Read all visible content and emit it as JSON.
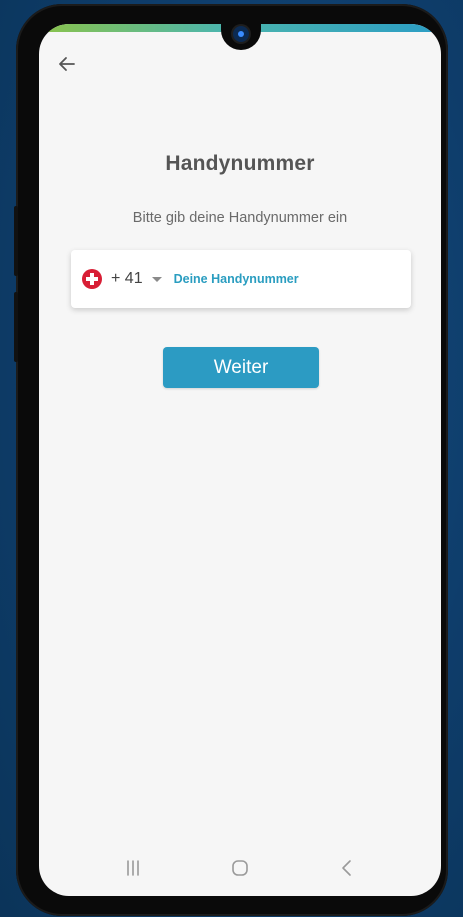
{
  "screen": {
    "title": "Handynummer",
    "subtitle": "Bitte gib deine Handynummer ein"
  },
  "phone_input": {
    "country_flag": "switzerland-flag-icon",
    "country_code": "+ 41",
    "value": "",
    "placeholder": "Deine Handynummer"
  },
  "actions": {
    "continue_label": "Weiter"
  },
  "icons": {
    "back": "arrow-left-icon",
    "dropdown": "caret-down-icon",
    "nav_recents": "recent-apps-icon",
    "nav_home": "home-icon",
    "nav_back": "back-chevron-icon"
  },
  "colors": {
    "accent": "#2c9bc3",
    "background": "#f6f6f6",
    "flag_red": "#d81e35"
  }
}
